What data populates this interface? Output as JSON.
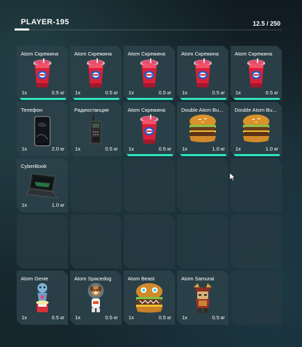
{
  "player": {
    "name": "PLAYER-195"
  },
  "weight": {
    "text": "12.5 / 250",
    "current": 12.5,
    "max": 250
  },
  "accent_color": "#2fe3c0",
  "slots": [
    {
      "name": "Atom Скрежина",
      "qty": "1x",
      "weight": "0.5 кг",
      "icon": "slushie-cup-icon",
      "bar": true
    },
    {
      "name": "Atom Скрежина",
      "qty": "1x",
      "weight": "0.5 кг",
      "icon": "slushie-cup-icon",
      "bar": true
    },
    {
      "name": "Atom Скрежина",
      "qty": "1x",
      "weight": "0.5 кг",
      "icon": "slushie-cup-icon",
      "bar": true
    },
    {
      "name": "Atom Скрежина",
      "qty": "1x",
      "weight": "0.5 кг",
      "icon": "slushie-cup-icon",
      "bar": true
    },
    {
      "name": "Atom Скрежина",
      "qty": "1x",
      "weight": "0.5 кг",
      "icon": "slushie-cup-icon",
      "bar": true
    },
    {
      "name": "Телефон",
      "qty": "1x",
      "weight": "2.0 кг",
      "icon": "smartphone-icon",
      "bar": false
    },
    {
      "name": "Радиостанция",
      "qty": "1x",
      "weight": "0.5 кг",
      "icon": "walkie-talkie-icon",
      "bar": false
    },
    {
      "name": "Atom Скрежина",
      "qty": "1x",
      "weight": "0.5 кг",
      "icon": "slushie-cup-icon",
      "bar": true
    },
    {
      "name": "Double Atom Bu...",
      "qty": "1x",
      "weight": "1.0 кг",
      "icon": "burger-icon",
      "bar": true
    },
    {
      "name": "Double Atom Bu...",
      "qty": "1x",
      "weight": "1.0 кг",
      "icon": "burger-icon",
      "bar": true
    },
    {
      "name": "CyberBook",
      "qty": "1x",
      "weight": "1.0 кг",
      "icon": "laptop-icon",
      "bar": false
    },
    null,
    null,
    null,
    null,
    null,
    null,
    null,
    null,
    null,
    {
      "name": "Atom Genie",
      "qty": "1x",
      "weight": "0.5 кг",
      "icon": "genie-figure-icon",
      "bar": false
    },
    {
      "name": "Atom Spacedog",
      "qty": "1x",
      "weight": "0.5 кг",
      "icon": "spacedog-figure-icon",
      "bar": false
    },
    {
      "name": "Atom Beast",
      "qty": "1x",
      "weight": "0.5 кг",
      "icon": "beast-burger-figure-icon",
      "bar": false
    },
    {
      "name": "Atom Samurai",
      "qty": "1x",
      "weight": "0.5 кг",
      "icon": "samurai-figure-icon",
      "bar": false
    },
    null
  ]
}
